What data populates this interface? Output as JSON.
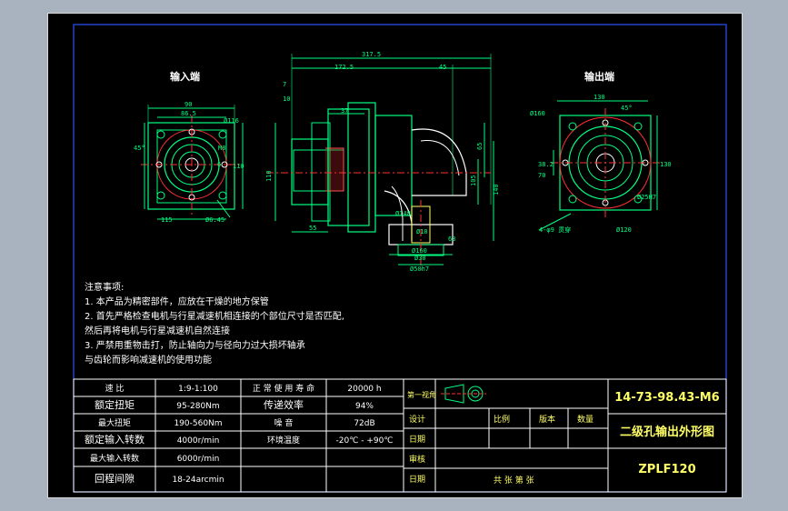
{
  "views": {
    "input_title": "输入端",
    "output_title": "输出端"
  },
  "dims": {
    "d90": "90",
    "d865": "86.5",
    "phi116": "Ø116",
    "m8": "M8",
    "d6": "6",
    "d110": "110",
    "d45a": "45°",
    "d115": "115",
    "phi645": "Ø6.45",
    "d3175": "317.5",
    "d1725": "172.5",
    "d45b": "45",
    "d37": "37",
    "d7": "7",
    "d10": "10",
    "d55": "55",
    "d65": "65",
    "d105": "105",
    "d140": "140",
    "phi10": "Ø10",
    "d63": "63",
    "phi160": "Ø160",
    "phi30": "Ø30",
    "phi50h7": "Ø50h7",
    "phi148": "Ø148",
    "d130": "130",
    "phi160b": "Ø160",
    "d45c": "45°",
    "d382": "38.2",
    "d70": "70",
    "d130b": "130",
    "phi25": "Ø25H7",
    "phi120": "Ø120",
    "holes": "4-φ9 贯穿"
  },
  "notes": {
    "heading": "注意事项:",
    "line1": "1. 本产品为精密部件，应放在干燥的地方保管",
    "line2": "2. 首先严格检查电机与行星减速机相连接的个部位尺寸是否匹配,",
    "line3": "然后再将电机与行星减速机自然连接",
    "line4": "3. 严禁用重物击打，防止轴向力与径向力过大损坏轴承",
    "line5": "与齿轮而影响减速机的使用功能"
  },
  "spec_table": {
    "rows": [
      [
        "速 比",
        "1:9-1:100",
        "正 常 使 用 寿 命",
        "20000 h"
      ],
      [
        "额定扭矩",
        "95-280Nm",
        "传递效率",
        "94%"
      ],
      [
        "最大扭矩",
        "190-560Nm",
        "噪 音",
        "72dB"
      ],
      [
        "额定输入转数",
        "4000r/min",
        "环境温度",
        "-20℃ - +90℃"
      ],
      [
        "最大输入转数",
        "6000r/min",
        "",
        ""
      ],
      [
        "回程间隙",
        "18-24arcmin",
        "",
        ""
      ]
    ]
  },
  "title_block": {
    "projection_label": "第一视角",
    "design": "设计",
    "date1": "日期",
    "review": "审核",
    "date2": "日期",
    "scale": "比例",
    "version": "版本",
    "quantity": "数量",
    "sheets": "共    张    第    张",
    "drawing_no": "14-73-98.43-M6",
    "drawing_title": "二级孔输出外形图",
    "model": "ZPLF120"
  }
}
